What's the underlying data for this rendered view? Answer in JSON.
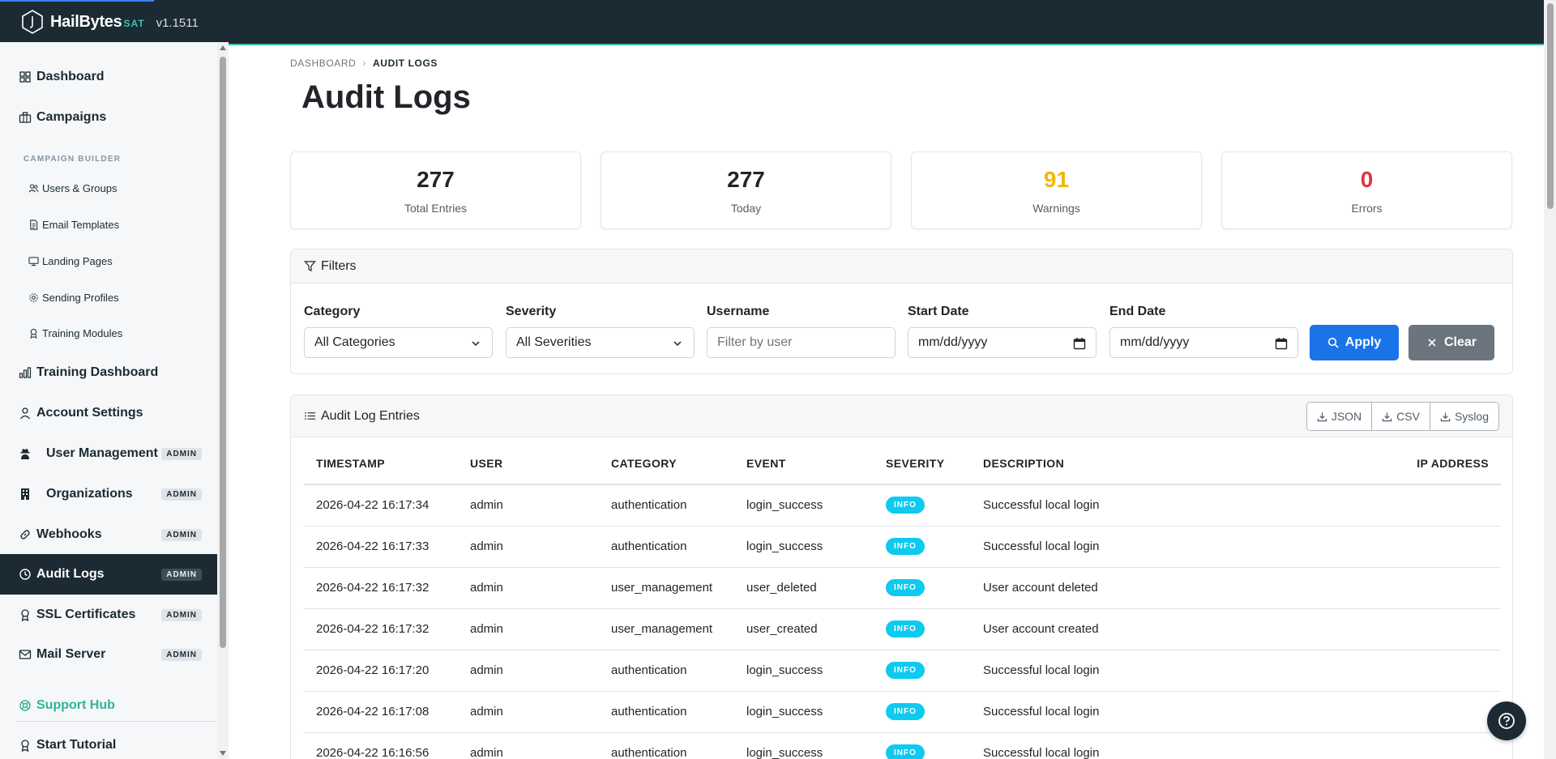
{
  "app": {
    "brand": "HailBytes",
    "product": "SAT",
    "version": "v1.1511"
  },
  "sidebar": {
    "items": [
      {
        "label": "Dashboard",
        "icon": "grid-icon"
      },
      {
        "label": "Campaigns",
        "icon": "briefcase-icon"
      }
    ],
    "section_label": "CAMPAIGN BUILDER",
    "sub_items": [
      {
        "label": "Users & Groups",
        "icon": "people-icon"
      },
      {
        "label": "Email Templates",
        "icon": "file-icon"
      },
      {
        "label": "Landing Pages",
        "icon": "monitor-icon"
      },
      {
        "label": "Sending Profiles",
        "icon": "gear-icon"
      },
      {
        "label": "Training Modules",
        "icon": "award-icon"
      }
    ],
    "lower_items": [
      {
        "label": "Training Dashboard",
        "icon": "bar-chart-icon",
        "badge": ""
      },
      {
        "label": "Account Settings",
        "icon": "person-icon",
        "badge": ""
      },
      {
        "label": "User Management",
        "icon": "user-secret-icon",
        "badge": "ADMIN"
      },
      {
        "label": "Organizations",
        "icon": "building-icon",
        "badge": "ADMIN"
      },
      {
        "label": "Webhooks",
        "icon": "link-icon",
        "badge": "ADMIN"
      },
      {
        "label": "Audit Logs",
        "icon": "clock-icon",
        "badge": "ADMIN",
        "active": true
      },
      {
        "label": "SSL Certificates",
        "icon": "award-icon",
        "badge": "ADMIN"
      },
      {
        "label": "Mail Server",
        "icon": "envelope-icon",
        "badge": "ADMIN"
      }
    ],
    "support": "Support Hub",
    "tutorial": "Start Tutorial"
  },
  "breadcrumb": {
    "root": "DASHBOARD",
    "sep": "›",
    "current": "AUDIT LOGS"
  },
  "page_title": "Audit Logs",
  "stats": [
    {
      "value": "277",
      "label": "Total Entries",
      "color": "#212529"
    },
    {
      "value": "277",
      "label": "Today",
      "color": "#212529"
    },
    {
      "value": "91",
      "label": "Warnings",
      "color": "#f2b705"
    },
    {
      "value": "0",
      "label": "Errors",
      "color": "#dc3545"
    }
  ],
  "filters": {
    "title": "Filters",
    "category": {
      "label": "Category",
      "value": "All Categories"
    },
    "severity": {
      "label": "Severity",
      "value": "All Severities"
    },
    "username": {
      "label": "Username",
      "placeholder": "Filter by user"
    },
    "start_date": {
      "label": "Start Date",
      "value": "mm/dd/yyyy"
    },
    "end_date": {
      "label": "End Date",
      "value": "mm/dd/yyyy"
    },
    "apply": "Apply",
    "clear": "Clear"
  },
  "log_card": {
    "title": "Audit Log Entries",
    "exports": [
      "JSON",
      "CSV",
      "Syslog"
    ]
  },
  "table": {
    "columns": [
      "Timestamp",
      "User",
      "Category",
      "Event",
      "Severity",
      "Description",
      "IP Address"
    ],
    "rows": [
      {
        "timestamp": "2026-04-22 16:17:34",
        "user": "admin",
        "category": "authentication",
        "event": "login_success",
        "severity": "INFO",
        "description": "Successful local login",
        "ip": ""
      },
      {
        "timestamp": "2026-04-22 16:17:33",
        "user": "admin",
        "category": "authentication",
        "event": "login_success",
        "severity": "INFO",
        "description": "Successful local login",
        "ip": ""
      },
      {
        "timestamp": "2026-04-22 16:17:32",
        "user": "admin",
        "category": "user_management",
        "event": "user_deleted",
        "severity": "INFO",
        "description": "User account deleted",
        "ip": ""
      },
      {
        "timestamp": "2026-04-22 16:17:32",
        "user": "admin",
        "category": "user_management",
        "event": "user_created",
        "severity": "INFO",
        "description": "User account created",
        "ip": ""
      },
      {
        "timestamp": "2026-04-22 16:17:20",
        "user": "admin",
        "category": "authentication",
        "event": "login_success",
        "severity": "INFO",
        "description": "Successful local login",
        "ip": ""
      },
      {
        "timestamp": "2026-04-22 16:17:08",
        "user": "admin",
        "category": "authentication",
        "event": "login_success",
        "severity": "INFO",
        "description": "Successful local login",
        "ip": ""
      },
      {
        "timestamp": "2026-04-22 16:16:56",
        "user": "admin",
        "category": "authentication",
        "event": "login_success",
        "severity": "INFO",
        "description": "Successful local login",
        "ip": ""
      }
    ]
  },
  "colors": {
    "accent": "#3ec1a8",
    "primary": "#1a73e8",
    "dark": "#1b2a33",
    "info": "#0dcaf0"
  }
}
